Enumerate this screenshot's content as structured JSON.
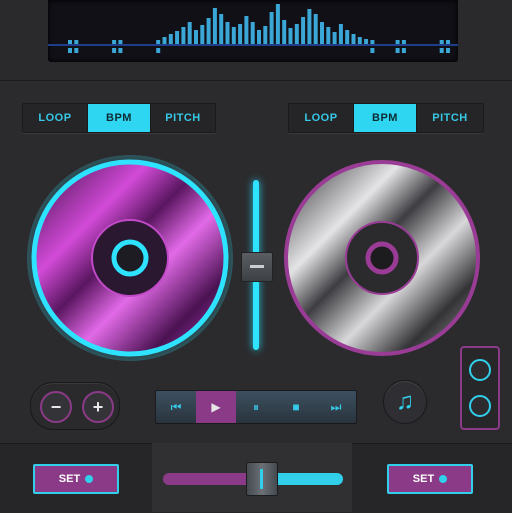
{
  "colors": {
    "accent_cyan": "#2fd6f2",
    "accent_magenta": "#8a3a86",
    "background": "#2b2b2d"
  },
  "left_deck": {
    "mode_buttons": [
      "LOOP",
      "BPM",
      "PITCH"
    ],
    "active_mode": "BPM",
    "platter_icon": "magenta-vinyl-platter-icon",
    "set_label": "SET"
  },
  "right_deck": {
    "mode_buttons": [
      "LOOP",
      "BPM",
      "PITCH"
    ],
    "active_mode": "BPM",
    "platter_icon": "silver-vinyl-platter-icon",
    "set_label": "SET"
  },
  "pitch_controls": {
    "minus": "−",
    "plus": "+"
  },
  "transport": {
    "prev": "⏮",
    "play": "▶",
    "pause": "⏸",
    "stop": "■",
    "next": "⏭"
  },
  "music_icon": "♫",
  "crossfader_position": 0.55,
  "channel_fader_position": 0.5
}
